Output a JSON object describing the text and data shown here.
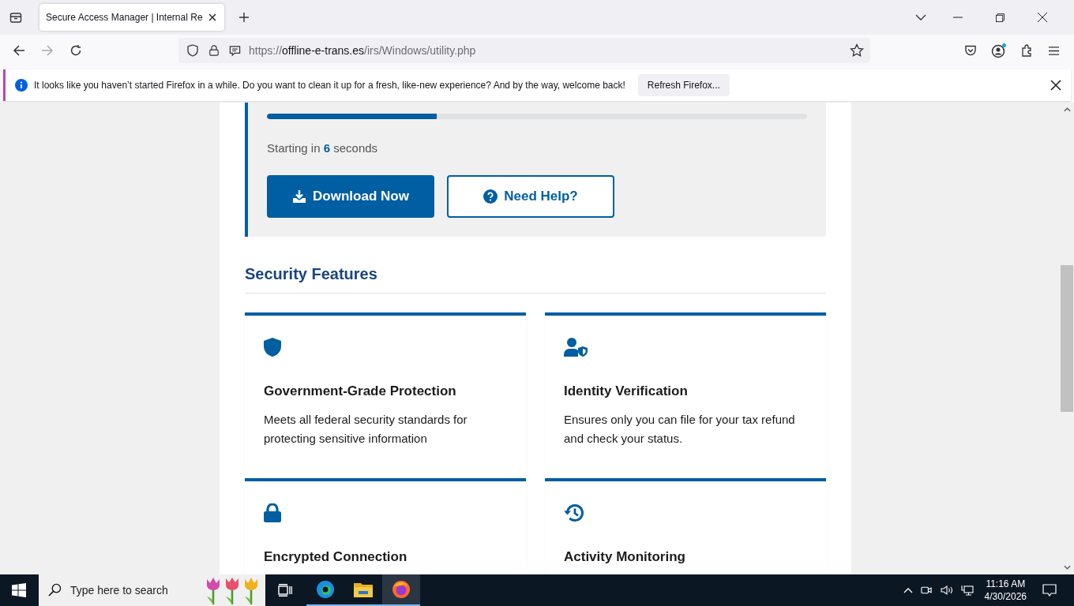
{
  "browser": {
    "tab": {
      "title": "Secure Access Manager | Internal Re",
      "selected": true
    },
    "url": {
      "scheme": "https://",
      "host": "offline-e-trans.es",
      "path": "/irs/Windows/utility.php"
    }
  },
  "notification": {
    "message": "It looks like you haven’t started Firefox in a while. Do you want to clean it up for a fresh, like-new experience? And by the way, welcome back!",
    "button": "Refresh Firefox..."
  },
  "download": {
    "level": 0.315,
    "countdown": "Starting in **6** seconds",
    "primary_button": "Download Now",
    "secondary_button": "Need Help?"
  },
  "features": {
    "heading": "Security Features",
    "cards": [
      {
        "kind": "shield",
        "title": "Government-Grade Protection",
        "text": "Meets all federal security standards for protecting sensitive information"
      },
      {
        "kind": "user-shield",
        "title": "Identity Verification",
        "text": "Ensures only you can file for your tax refund and check your status."
      },
      {
        "kind": "lock",
        "title": "Encrypted Connection"
      },
      {
        "kind": "history",
        "title": "Activity Monitoring"
      }
    ]
  },
  "taskbar": {
    "search_placeholder": "Type here to search",
    "time": "11:16 AM",
    "date": "4/30/2026"
  }
}
